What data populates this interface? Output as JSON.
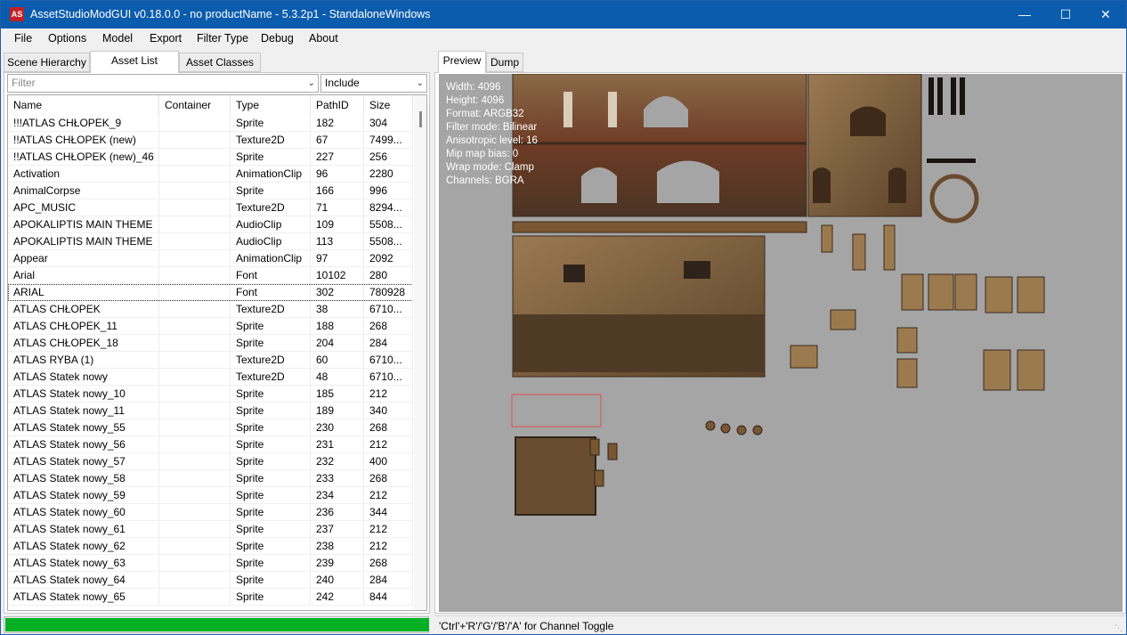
{
  "titlebar": {
    "title": "AssetStudioModGUI v0.18.0.0 - no productName - 5.3.2p1 - StandaloneWindows",
    "icon_text": "AS"
  },
  "menu": [
    "File",
    "Options",
    "Model",
    "Export",
    "Filter Type",
    "Debug",
    "About"
  ],
  "left_tabs": [
    "Scene Hierarchy",
    "Asset List",
    "Asset Classes"
  ],
  "filter": {
    "placeholder": "Filter",
    "mode": "Include"
  },
  "columns": [
    "Name",
    "Container",
    "Type",
    "PathID",
    "Size"
  ],
  "rows": [
    {
      "name": "!!!ATLAS CHŁOPEK_9",
      "container": "",
      "type": "Sprite",
      "path": "182",
      "size": "304"
    },
    {
      "name": "!!ATLAS CHŁOPEK (new)",
      "container": "",
      "type": "Texture2D",
      "path": "67",
      "size": "7499..."
    },
    {
      "name": "!!ATLAS CHŁOPEK (new)_46",
      "container": "",
      "type": "Sprite",
      "path": "227",
      "size": "256"
    },
    {
      "name": "Activation",
      "container": "",
      "type": "AnimationClip",
      "path": "96",
      "size": "2280"
    },
    {
      "name": "AnimalCorpse",
      "container": "",
      "type": "Sprite",
      "path": "166",
      "size": "996"
    },
    {
      "name": "APC_MUSIC",
      "container": "",
      "type": "Texture2D",
      "path": "71",
      "size": "8294..."
    },
    {
      "name": "APOKALIPTIS MAIN THEME",
      "container": "",
      "type": "AudioClip",
      "path": "109",
      "size": "5508..."
    },
    {
      "name": "APOKALIPTIS MAIN THEME",
      "container": "",
      "type": "AudioClip",
      "path": "113",
      "size": "5508..."
    },
    {
      "name": "Appear",
      "container": "",
      "type": "AnimationClip",
      "path": "97",
      "size": "2092"
    },
    {
      "name": "Arial",
      "container": "",
      "type": "Font",
      "path": "10102",
      "size": "280"
    },
    {
      "name": "ARIAL",
      "container": "",
      "type": "Font",
      "path": "302",
      "size": "780928"
    },
    {
      "name": "ATLAS CHŁOPEK",
      "container": "",
      "type": "Texture2D",
      "path": "38",
      "size": "6710..."
    },
    {
      "name": "ATLAS CHŁOPEK_11",
      "container": "",
      "type": "Sprite",
      "path": "188",
      "size": "268"
    },
    {
      "name": "ATLAS CHŁOPEK_18",
      "container": "",
      "type": "Sprite",
      "path": "204",
      "size": "284"
    },
    {
      "name": "ATLAS RYBA (1)",
      "container": "",
      "type": "Texture2D",
      "path": "60",
      "size": "6710..."
    },
    {
      "name": "ATLAS Statek nowy",
      "container": "",
      "type": "Texture2D",
      "path": "48",
      "size": "6710..."
    },
    {
      "name": "ATLAS Statek nowy_10",
      "container": "",
      "type": "Sprite",
      "path": "185",
      "size": "212"
    },
    {
      "name": "ATLAS Statek nowy_11",
      "container": "",
      "type": "Sprite",
      "path": "189",
      "size": "340"
    },
    {
      "name": "ATLAS Statek nowy_55",
      "container": "",
      "type": "Sprite",
      "path": "230",
      "size": "268"
    },
    {
      "name": "ATLAS Statek nowy_56",
      "container": "",
      "type": "Sprite",
      "path": "231",
      "size": "212"
    },
    {
      "name": "ATLAS Statek nowy_57",
      "container": "",
      "type": "Sprite",
      "path": "232",
      "size": "400"
    },
    {
      "name": "ATLAS Statek nowy_58",
      "container": "",
      "type": "Sprite",
      "path": "233",
      "size": "268"
    },
    {
      "name": "ATLAS Statek nowy_59",
      "container": "",
      "type": "Sprite",
      "path": "234",
      "size": "212"
    },
    {
      "name": "ATLAS Statek nowy_60",
      "container": "",
      "type": "Sprite",
      "path": "236",
      "size": "344"
    },
    {
      "name": "ATLAS Statek nowy_61",
      "container": "",
      "type": "Sprite",
      "path": "237",
      "size": "212"
    },
    {
      "name": "ATLAS Statek nowy_62",
      "container": "",
      "type": "Sprite",
      "path": "238",
      "size": "212"
    },
    {
      "name": "ATLAS Statek nowy_63",
      "container": "",
      "type": "Sprite",
      "path": "239",
      "size": "268"
    },
    {
      "name": "ATLAS Statek nowy_64",
      "container": "",
      "type": "Sprite",
      "path": "240",
      "size": "284"
    },
    {
      "name": "ATLAS Statek nowy_65",
      "container": "",
      "type": "Sprite",
      "path": "242",
      "size": "844"
    }
  ],
  "focused_row": 10,
  "progress": {
    "fraction": 1.0,
    "color": "#06b025"
  },
  "right_tabs": [
    "Preview",
    "Dump"
  ],
  "texture_info": [
    "Width: 4096",
    "Height: 4096",
    "Format: ARGB32",
    "Filter mode: Bilinear",
    "Anisotropic level: 16",
    "Mip map bias: 0",
    "Wrap mode: Clamp",
    "Channels: BGRA"
  ],
  "status": "'Ctrl'+'R'/'G'/'B'/'A' for Channel Toggle",
  "colors": {
    "title_bg": "#0b5cad",
    "preview_bg": "#a5a5a5",
    "atlas_brown": "#7a5632"
  }
}
